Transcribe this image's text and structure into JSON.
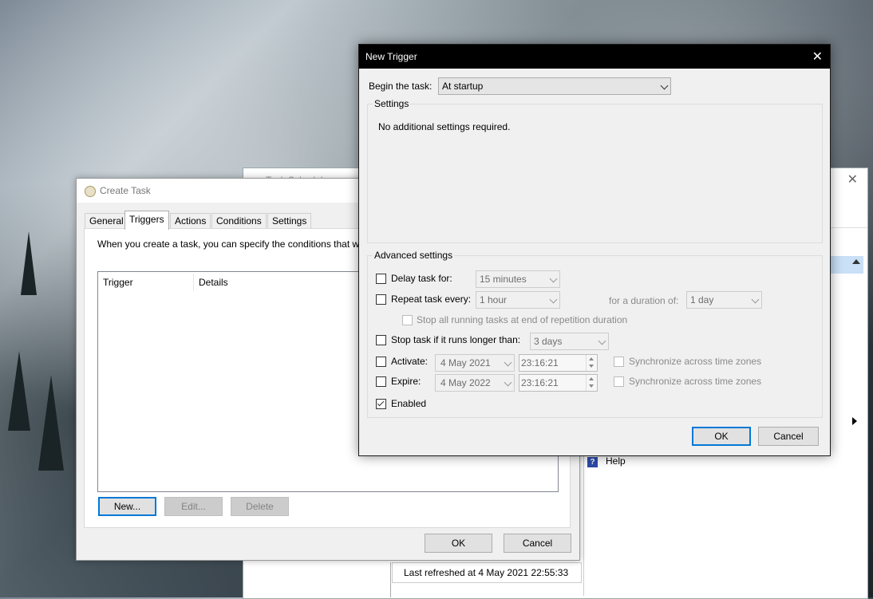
{
  "task_scheduler": {
    "title": "Task Scheduler",
    "help_label": "Help",
    "status_text": "Last refreshed at 4 May 2021 22:55:33"
  },
  "create_task": {
    "title": "Create Task",
    "tabs": [
      "General",
      "Triggers",
      "Actions",
      "Conditions",
      "Settings"
    ],
    "active_tab": "Triggers",
    "description": "When you create a task, you can specify the conditions that wi",
    "columns": [
      "Trigger",
      "Details"
    ],
    "new_label": "New...",
    "edit_label": "Edit...",
    "delete_label": "Delete",
    "ok_label": "OK",
    "cancel_label": "Cancel"
  },
  "new_trigger": {
    "title": "New Trigger",
    "begin_label": "Begin the task:",
    "begin_value": "At startup",
    "settings_label": "Settings",
    "settings_message": "No additional settings required.",
    "advanced_label": "Advanced settings",
    "delay_label": "Delay task for:",
    "delay_value": "15 minutes",
    "repeat_label": "Repeat task every:",
    "repeat_value": "1 hour",
    "duration_label": "for a duration of:",
    "duration_value": "1 day",
    "stop_all_label": "Stop all running tasks at end of repetition duration",
    "stop_longer_label": "Stop task if it runs longer than:",
    "stop_longer_value": "3 days",
    "activate_label": "Activate:",
    "activate_date": "4 May 2021",
    "activate_time": "23:16:21",
    "expire_label": "Expire:",
    "expire_date": "4 May 2022",
    "expire_time": "23:16:21",
    "sync_label": "Synchronize across time zones",
    "enabled_label": "Enabled",
    "enabled_checked": true,
    "ok_label": "OK",
    "cancel_label": "Cancel"
  },
  "colors": {
    "accent": "#0078d7",
    "title_dark": "#000000",
    "dialog_bg": "#f0f0f0"
  }
}
